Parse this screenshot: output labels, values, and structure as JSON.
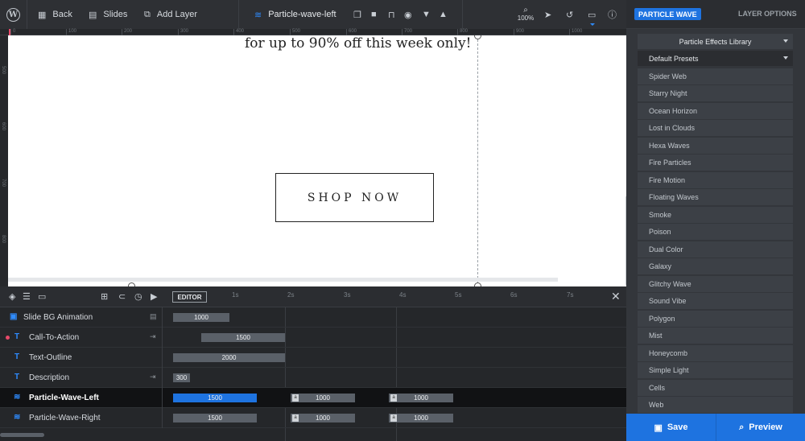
{
  "toolbar": {
    "back_label": "Back",
    "slides_label": "Slides",
    "add_layer_label": "Add Layer",
    "layer_name": "Particle-wave-left",
    "zoom": "100%"
  },
  "ruler": {
    "ticks": [
      "0",
      "100",
      "200",
      "300",
      "400",
      "500",
      "600",
      "700",
      "800",
      "900",
      "1000"
    ]
  },
  "vruler": {
    "ticks": [
      "500",
      "600",
      "700",
      "800"
    ]
  },
  "canvas": {
    "promo_text": "for up to 90% off this week only!",
    "button_label": "SHOP NOW"
  },
  "timeline": {
    "editor_label": "EDITOR",
    "seconds": [
      "1s",
      "2s",
      "3s",
      "4s",
      "5s",
      "6s",
      "7s"
    ],
    "rows": [
      {
        "name": "Slide BG Animation",
        "bars": [
          {
            "label": "1000"
          }
        ]
      },
      {
        "name": "Call-To-Action",
        "bars": [
          {
            "label": "1500"
          }
        ]
      },
      {
        "name": "Text-Outline",
        "bars": [
          {
            "label": "2000"
          }
        ]
      },
      {
        "name": "Description",
        "bars": [
          {
            "label": "300"
          }
        ]
      },
      {
        "name": "Particle-Wave-Left",
        "bars": [
          {
            "label": "1500"
          },
          {
            "label": "1000"
          },
          {
            "label": "1000"
          }
        ]
      },
      {
        "name": "Particle-Wave-Right",
        "bars": [
          {
            "label": "1500"
          },
          {
            "label": "1000"
          },
          {
            "label": "1000"
          }
        ]
      }
    ]
  },
  "panel": {
    "active_tab": "PARTICLE WAVE",
    "other_tab": "LAYER OPTIONS",
    "library_label": "Particle Effects Library",
    "presets_label": "Default Presets",
    "presets": [
      "Spider Web",
      "Starry Night",
      "Ocean Horizon",
      "Lost in Clouds",
      "Hexa Waves",
      "Fire Particles",
      "Fire Motion",
      "Floating Waves",
      "Smoke",
      "Poison",
      "Dual Color",
      "Galaxy",
      "Glitchy Wave",
      "Sound Vibe",
      "Polygon",
      "Mist",
      "Honeycomb",
      "Simple Light",
      "Cells",
      "Web"
    ],
    "save_label": "Save",
    "preview_label": "Preview"
  },
  "colors": {
    "accent": "#1e73e0",
    "marker": "#e84a6a",
    "canvas_bg": "#ffffff",
    "chrome": "#2e3034"
  }
}
